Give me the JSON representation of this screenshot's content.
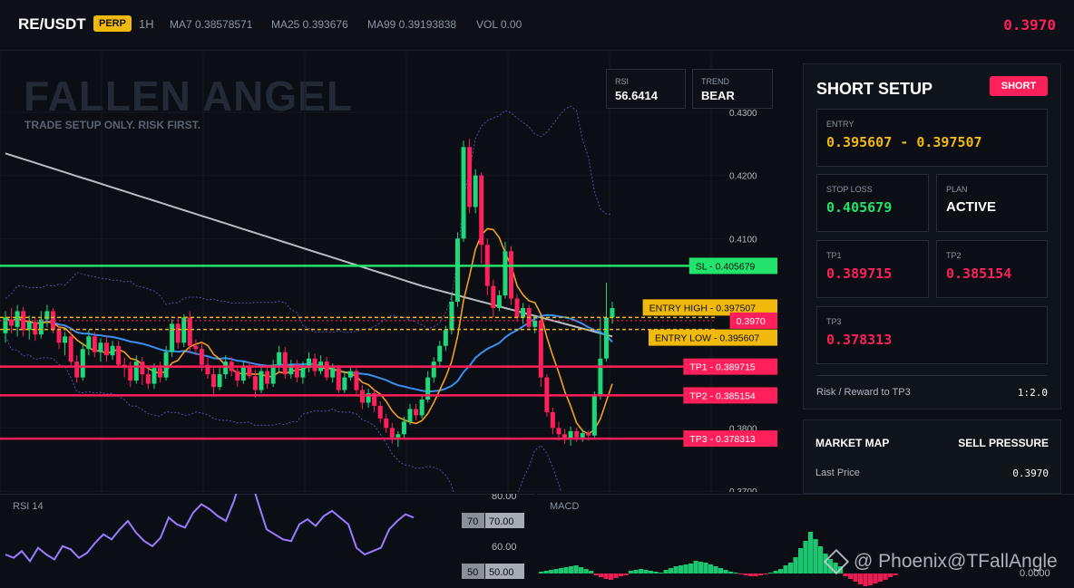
{
  "header": {
    "symbol": "RE/USDT",
    "badge": "PERP",
    "timeframe": "1H",
    "ma7": "MA7 0.38578571",
    "ma25": "MA25 0.393676",
    "ma99": "MA99 0.39193838",
    "volume": "VOL 0.00",
    "last_price": "0.3970"
  },
  "watermark": {
    "title": "FALLEN ANGEL",
    "subtitle": "TRADE SETUP ONLY. RISK FIRST."
  },
  "info_boxes": {
    "rsi_label": "RSI",
    "rsi_value": "56.6414",
    "trend_label": "TREND",
    "trend_value": "BEAR"
  },
  "chart_data": {
    "type": "candlestick",
    "price_axis_ticks": [
      "0.4300",
      "0.4200",
      "0.4100",
      "0.3800",
      "0.3700"
    ],
    "ylim": [
      0.37,
      0.43
    ],
    "levels": [
      {
        "label": "SL - 0.405679",
        "price": 0.405679,
        "style": "sl"
      },
      {
        "label": "ENTRY HIGH - 0.397507",
        "price": 0.397507,
        "style": "entry"
      },
      {
        "label": "0.3970",
        "price": 0.397,
        "style": "last"
      },
      {
        "label": "ENTRY LOW - 0.395607",
        "price": 0.395607,
        "style": "entry"
      },
      {
        "label": "TP1 - 0.389715",
        "price": 0.389715,
        "style": "tp"
      },
      {
        "label": "TP2 - 0.385154",
        "price": 0.385154,
        "style": "tp"
      },
      {
        "label": "TP3 - 0.378313",
        "price": 0.378313,
        "style": "tp"
      }
    ],
    "colors": {
      "up": "#1ed97a",
      "down": "#ff1f5a",
      "sl": "#22e36b",
      "entry": "#f0b90b",
      "tp": "#ff1f5a",
      "ma_fast": "#f0a020",
      "ma_mid": "#3a8ef0",
      "ma_slow": "#b8bcc4",
      "band": "#6a5acd"
    },
    "candles": [
      [
        0.395,
        0.3975,
        0.3935,
        0.3985
      ],
      [
        0.3972,
        0.3962,
        0.395,
        0.399
      ],
      [
        0.396,
        0.3985,
        0.3945,
        0.3995
      ],
      [
        0.3985,
        0.3955,
        0.3945,
        0.3992
      ],
      [
        0.3955,
        0.3968,
        0.394,
        0.3978
      ],
      [
        0.3968,
        0.3948,
        0.3938,
        0.3975
      ],
      [
        0.3948,
        0.3972,
        0.3942,
        0.3985
      ],
      [
        0.3972,
        0.3985,
        0.396,
        0.3995
      ],
      [
        0.3985,
        0.3955,
        0.395,
        0.399
      ],
      [
        0.3955,
        0.3935,
        0.3925,
        0.3962
      ],
      [
        0.3935,
        0.3945,
        0.3915,
        0.3952
      ],
      [
        0.3945,
        0.3905,
        0.3898,
        0.3952
      ],
      [
        0.3905,
        0.388,
        0.3872,
        0.3915
      ],
      [
        0.388,
        0.3925,
        0.3875,
        0.3935
      ],
      [
        0.3925,
        0.3945,
        0.3915,
        0.3955
      ],
      [
        0.3945,
        0.392,
        0.3912,
        0.3952
      ],
      [
        0.392,
        0.3935,
        0.3905,
        0.3942
      ],
      [
        0.3935,
        0.3915,
        0.3905,
        0.3945
      ],
      [
        0.3915,
        0.393,
        0.3908,
        0.3938
      ],
      [
        0.393,
        0.39,
        0.3895,
        0.3938
      ],
      [
        0.39,
        0.3895,
        0.388,
        0.3912
      ],
      [
        0.3895,
        0.3875,
        0.3865,
        0.3905
      ],
      [
        0.3875,
        0.3905,
        0.387,
        0.3915
      ],
      [
        0.3905,
        0.3885,
        0.3868,
        0.3912
      ],
      [
        0.3885,
        0.387,
        0.3862,
        0.3895
      ],
      [
        0.387,
        0.3895,
        0.3862,
        0.3902
      ],
      [
        0.3895,
        0.388,
        0.3872,
        0.3905
      ],
      [
        0.388,
        0.392,
        0.3875,
        0.393
      ],
      [
        0.392,
        0.3965,
        0.3912,
        0.3972
      ],
      [
        0.3965,
        0.3935,
        0.3925,
        0.3975
      ],
      [
        0.3935,
        0.3975,
        0.3928,
        0.398
      ],
      [
        0.3975,
        0.393,
        0.392,
        0.3985
      ],
      [
        0.393,
        0.3925,
        0.3915,
        0.394
      ],
      [
        0.3925,
        0.39,
        0.389,
        0.3935
      ],
      [
        0.39,
        0.3885,
        0.3878,
        0.3912
      ],
      [
        0.3885,
        0.3865,
        0.385,
        0.3895
      ],
      [
        0.3865,
        0.3885,
        0.386,
        0.3895
      ],
      [
        0.3885,
        0.3905,
        0.3878,
        0.3915
      ],
      [
        0.3905,
        0.389,
        0.3882,
        0.3912
      ],
      [
        0.389,
        0.3875,
        0.3865,
        0.3898
      ],
      [
        0.3875,
        0.3898,
        0.387,
        0.3905
      ],
      [
        0.3898,
        0.3882,
        0.3878,
        0.3905
      ],
      [
        0.3882,
        0.386,
        0.3848,
        0.3892
      ],
      [
        0.386,
        0.389,
        0.3855,
        0.39
      ],
      [
        0.389,
        0.387,
        0.3862,
        0.3898
      ],
      [
        0.387,
        0.39,
        0.3865,
        0.3908
      ],
      [
        0.39,
        0.392,
        0.389,
        0.393
      ],
      [
        0.392,
        0.3885,
        0.3878,
        0.3928
      ],
      [
        0.3885,
        0.39,
        0.3878,
        0.3908
      ],
      [
        0.39,
        0.388,
        0.3872,
        0.3908
      ],
      [
        0.388,
        0.3895,
        0.387,
        0.3905
      ],
      [
        0.3895,
        0.391,
        0.3888,
        0.392
      ],
      [
        0.391,
        0.389,
        0.3882,
        0.3918
      ],
      [
        0.389,
        0.3905,
        0.3885,
        0.3915
      ],
      [
        0.3905,
        0.388,
        0.3875,
        0.3912
      ],
      [
        0.388,
        0.3895,
        0.3872,
        0.3902
      ],
      [
        0.3895,
        0.386,
        0.3855,
        0.39
      ],
      [
        0.386,
        0.388,
        0.3855,
        0.3888
      ],
      [
        0.388,
        0.389,
        0.3875,
        0.3898
      ],
      [
        0.389,
        0.386,
        0.3852,
        0.3895
      ],
      [
        0.386,
        0.384,
        0.383,
        0.3868
      ],
      [
        0.384,
        0.3855,
        0.3832,
        0.3862
      ],
      [
        0.3855,
        0.3835,
        0.3825,
        0.3862
      ],
      [
        0.3835,
        0.3815,
        0.3808,
        0.3842
      ],
      [
        0.3815,
        0.38,
        0.3792,
        0.3822
      ],
      [
        0.38,
        0.3785,
        0.3775,
        0.3808
      ],
      [
        0.3785,
        0.379,
        0.377,
        0.3795
      ],
      [
        0.379,
        0.381,
        0.3782,
        0.3818
      ],
      [
        0.381,
        0.383,
        0.3805,
        0.3838
      ],
      [
        0.383,
        0.382,
        0.3812,
        0.3838
      ],
      [
        0.382,
        0.3845,
        0.3815,
        0.3852
      ],
      [
        0.3845,
        0.388,
        0.384,
        0.389
      ],
      [
        0.388,
        0.3905,
        0.3872,
        0.3912
      ],
      [
        0.3905,
        0.393,
        0.3898,
        0.3938
      ],
      [
        0.393,
        0.3955,
        0.3922,
        0.3962
      ],
      [
        0.3955,
        0.4,
        0.3948,
        0.4012
      ],
      [
        0.4,
        0.41,
        0.3992,
        0.411
      ],
      [
        0.41,
        0.4245,
        0.4095,
        0.4255
      ],
      [
        0.4245,
        0.415,
        0.414,
        0.4258
      ],
      [
        0.415,
        0.42,
        0.414,
        0.421
      ],
      [
        0.42,
        0.409,
        0.406,
        0.4205
      ],
      [
        0.409,
        0.4025,
        0.401,
        0.41
      ],
      [
        0.4025,
        0.399,
        0.3975,
        0.4035
      ],
      [
        0.399,
        0.401,
        0.3985,
        0.4018
      ],
      [
        0.401,
        0.408,
        0.4005,
        0.4095
      ],
      [
        0.408,
        0.4005,
        0.3995,
        0.4088
      ],
      [
        0.4005,
        0.3975,
        0.3968,
        0.4012
      ],
      [
        0.3975,
        0.399,
        0.3965,
        0.3998
      ],
      [
        0.399,
        0.396,
        0.3955,
        0.3995
      ],
      [
        0.396,
        0.397,
        0.395,
        0.3978
      ],
      [
        0.397,
        0.388,
        0.3865,
        0.3975
      ],
      [
        0.388,
        0.3825,
        0.3818,
        0.3885
      ],
      [
        0.3825,
        0.38,
        0.379,
        0.3832
      ],
      [
        0.38,
        0.379,
        0.378,
        0.381
      ],
      [
        0.379,
        0.3782,
        0.3775,
        0.3798
      ],
      [
        0.3782,
        0.3795,
        0.3772,
        0.3802
      ],
      [
        0.3795,
        0.3785,
        0.3778,
        0.38
      ],
      [
        0.3785,
        0.3792,
        0.3778,
        0.3798
      ],
      [
        0.3792,
        0.3788,
        0.378,
        0.3796
      ],
      [
        0.3788,
        0.385,
        0.3785,
        0.3858
      ],
      [
        0.385,
        0.391,
        0.3845,
        0.3975
      ],
      [
        0.391,
        0.3975,
        0.3905,
        0.403
      ],
      [
        0.3975,
        0.399,
        0.3965,
        0.4
      ]
    ]
  },
  "panes": {
    "rsi_title": "RSI 14",
    "rsi_ticks": [
      "80.00",
      "60.00"
    ],
    "rsi_marker_70_label": "70",
    "rsi_marker_70_value": "70.00",
    "rsi_marker_50_label": "50",
    "rsi_marker_50_value": "50.00",
    "macd_title": "MACD",
    "macd_tick": "0.0000"
  },
  "setup": {
    "title": "SHORT SETUP",
    "badge": "SHORT",
    "entry_label": "ENTRY",
    "entry_value": "0.395607 - 0.397507",
    "sl_label": "STOP LOSS",
    "sl_value": "0.405679",
    "plan_label": "PLAN",
    "plan_value": "ACTIVE",
    "tp1_label": "TP1",
    "tp1_value": "0.389715",
    "tp2_label": "TP2",
    "tp2_value": "0.385154",
    "tp3_label": "TP3",
    "tp3_value": "0.378313",
    "rr_label": "Risk / Reward to TP3",
    "rr_value": "1:2.0"
  },
  "market_map": {
    "title": "MARKET MAP",
    "pressure": "SELL PRESSURE",
    "last_price_label": "Last Price",
    "last_price_value": "0.3970"
  },
  "footer_watermark": "@ Phoenix@TFallAngle"
}
